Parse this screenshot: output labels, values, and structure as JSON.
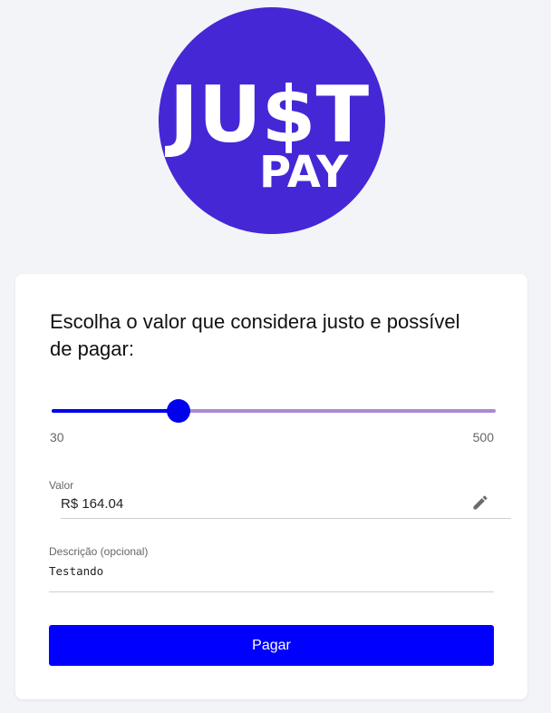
{
  "logo": {
    "word": "JU$T",
    "sub": "PAY",
    "bg_color": "#4527d6",
    "fg_color": "#ffffff"
  },
  "form": {
    "heading": "Escolha o valor que considera justo e possível de pagar:",
    "slider": {
      "min_label": "30",
      "max_label": "500",
      "min": 30,
      "max": 500,
      "value": 164.04,
      "fill_color": "#0000ee",
      "track_color": "#a98ad6"
    },
    "valor": {
      "label": "Valor",
      "value": "R$ 164.04",
      "icon": "pencil-icon"
    },
    "descricao": {
      "label": "Descrição (opcional)",
      "value": "Testando"
    },
    "submit": {
      "label": "Pagar",
      "color": "#0000ff"
    }
  }
}
